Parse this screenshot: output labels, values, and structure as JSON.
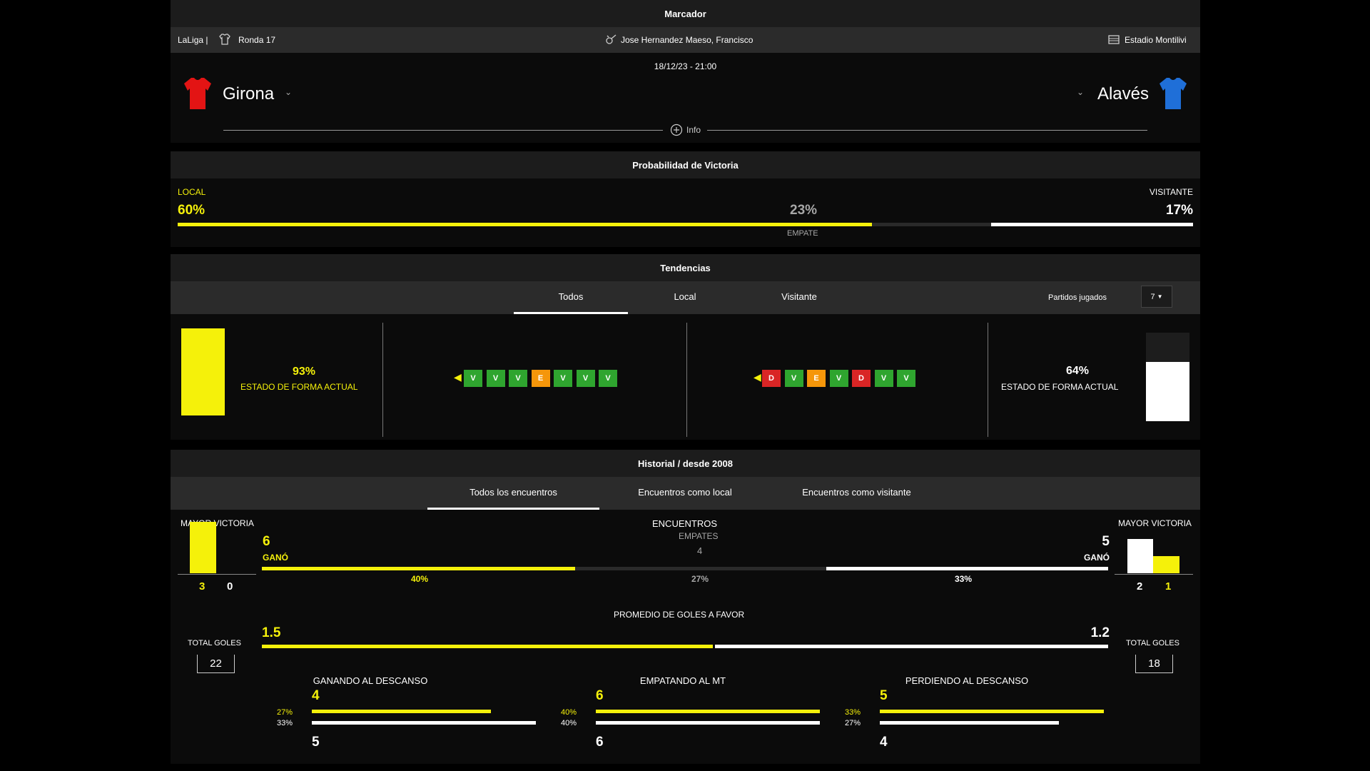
{
  "header": {
    "title": "Marcador",
    "league": "LaLiga |",
    "round": "Ronda 17",
    "referee": "Jose Hernandez Maeso, Francisco",
    "stadium": "Estadio Montilivi",
    "datetime": "18/12/23 - 21:00",
    "home_team": "Girona",
    "away_team": "Alavés",
    "info_label": "Info",
    "home_shirt_color": "#e31414",
    "away_shirt_color": "#1f6fd8"
  },
  "probability": {
    "title": "Probabilidad de Victoria",
    "local_label": "LOCAL",
    "local_value": "60%",
    "draw_value": "23%",
    "draw_label": "EMPATE",
    "away_label": "VISITANTE",
    "away_value": "17%",
    "local_fraction": 0.6,
    "draw_fraction": 0.23,
    "away_fraction": 0.17
  },
  "trends": {
    "title": "Tendencias",
    "tabs": [
      "Todos",
      "Local",
      "Visitante"
    ],
    "active_tab": "Todos",
    "played_label": "Partidos jugados",
    "played_value": "7",
    "home_form_value": "93%",
    "home_form_label": "ESTADO DE FORMA ACTUAL",
    "home_form_level": 0.93,
    "away_form_value": "64%",
    "away_form_label": "ESTADO DE FORMA ACTUAL",
    "away_form_level": 0.64,
    "home_results": [
      "V",
      "V",
      "V",
      "E",
      "V",
      "V",
      "V"
    ],
    "away_results": [
      "D",
      "V",
      "E",
      "V",
      "D",
      "V",
      "V"
    ],
    "result_colors": {
      "V": "#2fa52f",
      "E": "#f5960a",
      "D": "#d92525"
    }
  },
  "history": {
    "title": "Historial / desde 2008",
    "tabs": [
      "Todos los encuentros",
      "Encuentros como local",
      "Encuentros como visitante"
    ],
    "active_tab": "Todos los encuentros",
    "home": {
      "biggest_win_label": "MAYOR VICTORIA",
      "biggest_win_for": "3",
      "biggest_win_against": "0",
      "total_goals_label": "TOTAL GOLES",
      "total_goals": "22"
    },
    "away": {
      "biggest_win_label": "MAYOR VICTORIA",
      "biggest_win_for": "2",
      "biggest_win_against": "1",
      "total_goals_label": "TOTAL GOLES",
      "total_goals": "18"
    },
    "encounters": {
      "label": "ENCUENTROS",
      "home_wins": "6",
      "home_wins_label": "GANÓ",
      "home_pct": "40%",
      "draws_label": "EMPATES",
      "draws": "4",
      "draws_pct": "27%",
      "away_wins": "5",
      "away_wins_label": "GANÓ",
      "away_pct": "33%"
    },
    "goals_avg": {
      "label": "PROMEDIO DE GOLES A FAVOR",
      "home": "1.5",
      "away": "1.2"
    },
    "halftime": [
      {
        "label": "GANANDO AL DESCANSO",
        "home_value": "4",
        "home_pct": "27%",
        "away_pct": "33%",
        "away_value": "5"
      },
      {
        "label": "EMPATANDO AL MT",
        "home_value": "6",
        "home_pct": "40%",
        "away_pct": "40%",
        "away_value": "6"
      },
      {
        "label": "PERDIENDO AL DESCANSO",
        "home_value": "5",
        "home_pct": "33%",
        "away_pct": "27%",
        "away_value": "4"
      }
    ]
  }
}
